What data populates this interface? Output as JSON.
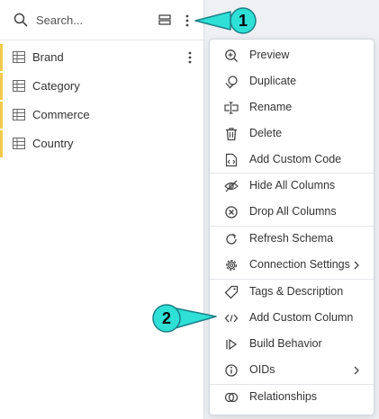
{
  "search": {
    "placeholder": "Search..."
  },
  "tables": [
    {
      "label": "Brand"
    },
    {
      "label": "Category"
    },
    {
      "label": "Commerce"
    },
    {
      "label": "Country"
    }
  ],
  "menu": {
    "items": [
      {
        "label": "Preview",
        "icon": "zoom-in-icon"
      },
      {
        "label": "Duplicate",
        "icon": "duplicate-icon"
      },
      {
        "label": "Rename",
        "icon": "rename-icon"
      },
      {
        "label": "Delete",
        "icon": "trash-icon"
      },
      {
        "label": "Add Custom Code",
        "icon": "code-file-icon"
      },
      {
        "label": "Hide All Columns",
        "icon": "eye-off-icon"
      },
      {
        "label": "Drop All Columns",
        "icon": "circle-x-icon"
      },
      {
        "label": "Refresh Schema",
        "icon": "refresh-icon"
      },
      {
        "label": "Connection Settings",
        "icon": "gear-icon"
      },
      {
        "label": "Tags & Description",
        "icon": "tag-icon"
      },
      {
        "label": "Add Custom Column",
        "icon": "code-brackets-icon"
      },
      {
        "label": "Build Behavior",
        "icon": "behavior-icon"
      },
      {
        "label": "OIDs",
        "icon": "info-icon"
      },
      {
        "label": "Relationships",
        "icon": "relationships-icon"
      }
    ]
  },
  "callouts": [
    {
      "label": "1"
    },
    {
      "label": "2"
    }
  ],
  "colors": {
    "accent_yellow": "#f2c94c",
    "callout_fill": "#2ee0d6",
    "callout_stroke": "#1a7f86"
  }
}
